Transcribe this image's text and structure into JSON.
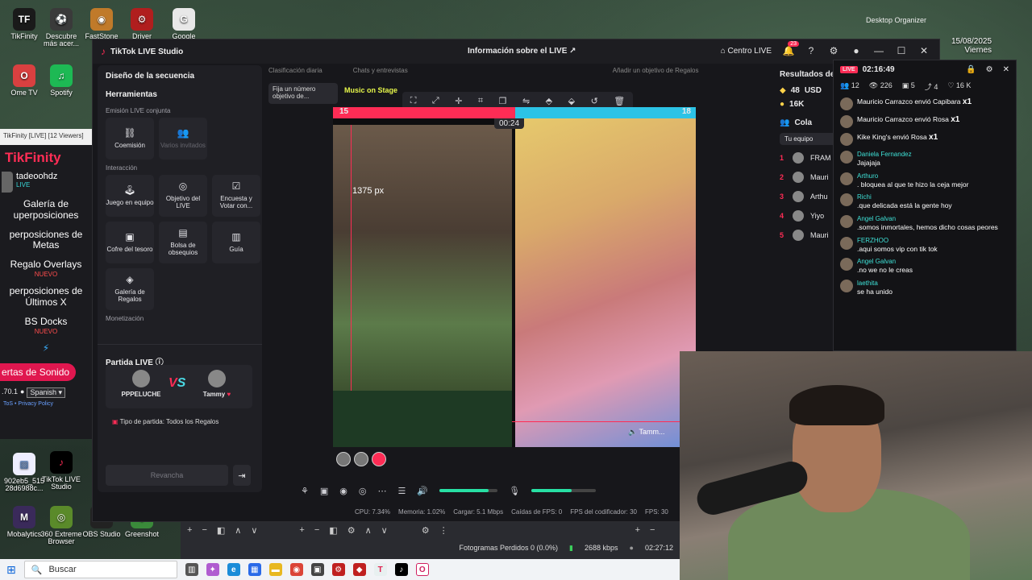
{
  "desktop": {
    "icons": [
      {
        "label": "TikFinity",
        "color": "#1a1a1a",
        "glyph": "TF"
      },
      {
        "label": "Descubre más acer...",
        "color": "#3a3a3a",
        "glyph": "⚽"
      },
      {
        "label": "FastStone Im...",
        "color": "#c07a2a",
        "glyph": "◉"
      },
      {
        "label": "Driver",
        "color": "#b01e1e",
        "glyph": "⚙"
      },
      {
        "label": "Google",
        "color": "#e8e8e8",
        "glyph": "G"
      },
      {
        "label": "Ome TV",
        "color": "#d94040",
        "glyph": "O"
      },
      {
        "label": "Spotify",
        "color": "#1db954",
        "glyph": "♫"
      },
      {
        "label": "TikTok LIVE Studio",
        "color": "#000000",
        "glyph": "♪"
      },
      {
        "label": "Mobalytics",
        "color": "#3a2a5a",
        "glyph": "M"
      },
      {
        "label": "360 Extreme Browser",
        "color": "#5a8a2a",
        "glyph": "◎"
      },
      {
        "label": "OBS Studio",
        "color": "#222222",
        "glyph": "●"
      },
      {
        "label": "Greenshot",
        "color": "#3a8a3a",
        "glyph": "◆"
      }
    ],
    "file_label": "902eb5_515 28d6988c...",
    "organizer": "Desktop Organizer",
    "date": "15/08/2025",
    "day": "Viernes"
  },
  "tikfinity": {
    "window_title": "TikFinity [LIVE] [12 Viewers]",
    "brand": "TikFinity",
    "user": "tadeoohdz",
    "status": "LIVE",
    "menu": [
      {
        "label": "Galería de uperposiciones",
        "new": ""
      },
      {
        "label": "perposiciones de Metas",
        "new": ""
      },
      {
        "label": "Regalo Overlays",
        "new": "NUEVO"
      },
      {
        "label": "perposiciones de Últimos X",
        "new": ""
      },
      {
        "label": "BS Docks",
        "new": "NUEVO"
      }
    ],
    "sound_button": "ertas de Sonido",
    "version": ".70.1",
    "language": "Spanish",
    "tos": "ToS • Privacy Policy"
  },
  "studio": {
    "app_title": "TikTok LIVE Studio",
    "center_title": "Información sobre el LIVE",
    "centro_live": "Centro LIVE",
    "notif_count": "23",
    "left": {
      "design": "Diseño de la secuencia",
      "tools": "Herramientas",
      "joint": "Emisión LIVE conjunta",
      "joint_tiles": [
        {
          "label": "Coemisión",
          "icon": "link-icon",
          "glyph": "⛓",
          "disabled": false
        },
        {
          "label": "Varios invitados",
          "icon": "users-icon",
          "glyph": "👥",
          "disabled": true
        }
      ],
      "interaction": "Interacción",
      "interaction_tiles": [
        {
          "label": "Juego en equipo",
          "icon": "joystick-icon",
          "glyph": "🕹"
        },
        {
          "label": "Objetivo del LIVE",
          "icon": "target-icon",
          "glyph": "◎"
        },
        {
          "label": "Encuesta y Votar con...",
          "icon": "poll-icon",
          "glyph": "☑"
        },
        {
          "label": "Cofre del tesoro",
          "icon": "chest-icon",
          "glyph": "▣"
        },
        {
          "label": "Bolsa de obsequios",
          "icon": "gift-bag-icon",
          "glyph": "▤"
        },
        {
          "label": "Guía",
          "icon": "book-icon",
          "glyph": "▥"
        },
        {
          "label": "Galería de Regalos",
          "icon": "gift-gallery-icon",
          "glyph": "◈"
        }
      ],
      "monetization": "Monetización",
      "battle_title": "Partida LIVE",
      "player1": "PPPELUCHE",
      "player2": "Tammy",
      "vs": "VS",
      "battle_type": "Tipo de partida: Todos los Regalos",
      "rematch": "Revancha"
    },
    "center": {
      "chip1": "Clasificación diaria",
      "chip2": "Chats y entrevistas",
      "chip3": "Añadir un objetivo de Regalos",
      "pin_goal": "Fija un número objetivo de...",
      "music": "Music on Stage",
      "score_left": "15",
      "score_right": "18",
      "timer": "00:24",
      "px_label": "1375 px",
      "guest": "Tamm...",
      "mic_level": 0.62,
      "speaker_level": 0.85,
      "stats": [
        "CPU: 7.34%",
        "Memoria: 1.02%",
        "Cargar: 5.1 Mbps",
        "Caídas de FPS: 0",
        "FPS del codificador: 30",
        "FPS: 30"
      ]
    },
    "results": {
      "title": "Resultados del",
      "likes": "48",
      "usd": "USD",
      "coins": "16K",
      "collab": "Cola",
      "team": "Tu equipo",
      "ranking": [
        {
          "n": "1",
          "name": "FRAM"
        },
        {
          "n": "2",
          "name": "Mauri"
        },
        {
          "n": "3",
          "name": "Arthu"
        },
        {
          "n": "4",
          "name": "Yiyo"
        },
        {
          "n": "5",
          "name": "Mauri"
        }
      ]
    }
  },
  "chat": {
    "live": "LIVE",
    "time": "02:16:49",
    "stats": [
      "12",
      "226",
      "5",
      "4",
      "16 K"
    ],
    "messages": [
      {
        "user": "",
        "text": "Mauricio Carrazco envió Capibara",
        "mult": "x1"
      },
      {
        "user": "",
        "text": "Mauricio Carrazco envió Rosa",
        "mult": "x1"
      },
      {
        "user": "",
        "text": "Kike King's envió Rosa",
        "mult": "x1"
      },
      {
        "user": "Daniela Fernandez",
        "text": "Jajajaja",
        "mult": ""
      },
      {
        "user": "Arthuro",
        "text": ". bloquea al que te hizo la ceja mejor",
        "mult": ""
      },
      {
        "user": "Richi",
        "text": ".que delicada está la gente hoy",
        "mult": ""
      },
      {
        "user": "Angel Galvan",
        "text": ".somos inmortales, hemos dicho cosas peores",
        "mult": ""
      },
      {
        "user": "FERZHOO",
        "text": ".aqui somos vip con tik tok",
        "mult": ""
      },
      {
        "user": "Angel Galvan",
        "text": ".no we no le creas",
        "mult": ""
      },
      {
        "user": "laethita",
        "text": "se ha unido",
        "mult": ""
      }
    ]
  },
  "obs": {
    "dropped": "Fotogramas Perdidos 0 (0.0%)",
    "kbps": "2688 kbps",
    "time": "02:27:12"
  },
  "taskbar": {
    "search": "Buscar"
  }
}
